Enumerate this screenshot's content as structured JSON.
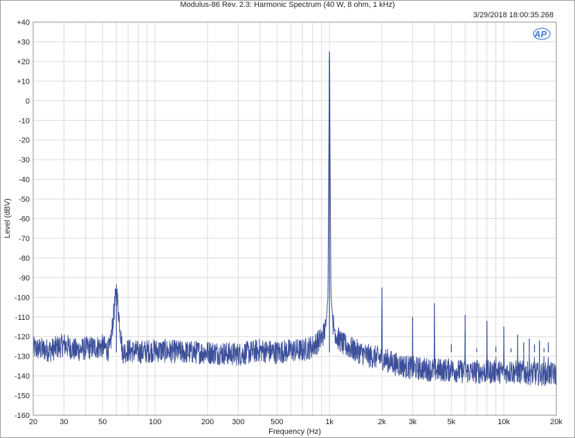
{
  "chart_data": {
    "type": "line",
    "title": "Modulus-86 Rev. 2.3: Harmonic Spectrum (40 W, 8 ohm, 1 kHz)",
    "timestamp": "3/29/2018 18:00:35.268",
    "logo_text": "AP",
    "xlabel": "Frequency (Hz)",
    "ylabel": "Level (dBV)",
    "x_scale": "log",
    "xlim": [
      20,
      20000
    ],
    "ylim": [
      -160,
      40
    ],
    "grid": true,
    "line_color": "#3b4f9a",
    "x_ticks": [
      {
        "value": 20,
        "label": "20"
      },
      {
        "value": 30,
        "label": "30"
      },
      {
        "value": 50,
        "label": "50"
      },
      {
        "value": 100,
        "label": "100"
      },
      {
        "value": 200,
        "label": "200"
      },
      {
        "value": 300,
        "label": "300"
      },
      {
        "value": 500,
        "label": "500"
      },
      {
        "value": 1000,
        "label": "1k"
      },
      {
        "value": 2000,
        "label": "2k"
      },
      {
        "value": 3000,
        "label": "3k"
      },
      {
        "value": 5000,
        "label": "5k"
      },
      {
        "value": 10000,
        "label": "10k"
      },
      {
        "value": 20000,
        "label": "20k"
      }
    ],
    "y_ticks": [
      {
        "value": 40,
        "label": "+40"
      },
      {
        "value": 30,
        "label": "+30"
      },
      {
        "value": 20,
        "label": "+20"
      },
      {
        "value": 10,
        "label": "+10"
      },
      {
        "value": 0,
        "label": "0"
      },
      {
        "value": -10,
        "label": "-10"
      },
      {
        "value": -20,
        "label": "-20"
      },
      {
        "value": -30,
        "label": "-30"
      },
      {
        "value": -40,
        "label": "-40"
      },
      {
        "value": -50,
        "label": "-50"
      },
      {
        "value": -60,
        "label": "-60"
      },
      {
        "value": -70,
        "label": "-70"
      },
      {
        "value": -80,
        "label": "-80"
      },
      {
        "value": -90,
        "label": "-90"
      },
      {
        "value": -100,
        "label": "-100"
      },
      {
        "value": -110,
        "label": "-110"
      },
      {
        "value": -120,
        "label": "-120"
      },
      {
        "value": -130,
        "label": "-130"
      },
      {
        "value": -140,
        "label": "-140"
      },
      {
        "value": -150,
        "label": "-150"
      },
      {
        "value": -160,
        "label": "-160"
      }
    ],
    "series": [
      {
        "x": [
          20,
          25,
          30,
          35,
          40,
          50,
          55,
          60,
          65,
          70,
          80,
          100,
          150,
          200,
          300,
          350,
          400,
          500,
          600,
          700,
          800,
          900,
          950,
          980,
          1000,
          1020,
          1050,
          1100,
          1200,
          1400,
          1700,
          2000,
          2400,
          3000,
          4000,
          5000,
          6000,
          7000,
          8000,
          10000,
          12000,
          15000,
          20000
        ],
        "y": [
          -126,
          -127,
          -124,
          -127,
          -126,
          -125,
          -127,
          -96,
          -128,
          -127,
          -128,
          -127,
          -128,
          -128,
          -129,
          -128,
          -127,
          -128,
          -127,
          -127,
          -125,
          -121,
          -116,
          -100,
          25,
          -98,
          -114,
          -120,
          -124,
          -127,
          -130,
          -131,
          -134,
          -136,
          -137,
          -137,
          -138,
          -138,
          -138,
          -138,
          -138,
          -139,
          -139
        ]
      }
    ],
    "peaks": [
      {
        "x": 60,
        "y": -96
      },
      {
        "x": 1000,
        "y": 25
      },
      {
        "x": 2000,
        "y": -95
      },
      {
        "x": 3000,
        "y": -110
      },
      {
        "x": 4000,
        "y": -103
      },
      {
        "x": 5000,
        "y": -124
      },
      {
        "x": 6000,
        "y": -109
      },
      {
        "x": 7000,
        "y": -126
      },
      {
        "x": 8000,
        "y": -112
      },
      {
        "x": 9000,
        "y": -125
      },
      {
        "x": 10000,
        "y": -115
      },
      {
        "x": 11000,
        "y": -126
      },
      {
        "x": 12000,
        "y": -119
      },
      {
        "x": 13000,
        "y": -123
      },
      {
        "x": 14000,
        "y": -121
      },
      {
        "x": 15000,
        "y": -124
      },
      {
        "x": 16000,
        "y": -122
      },
      {
        "x": 17000,
        "y": -126
      },
      {
        "x": 18000,
        "y": -123
      },
      {
        "x": 19000,
        "y": -128
      }
    ]
  }
}
